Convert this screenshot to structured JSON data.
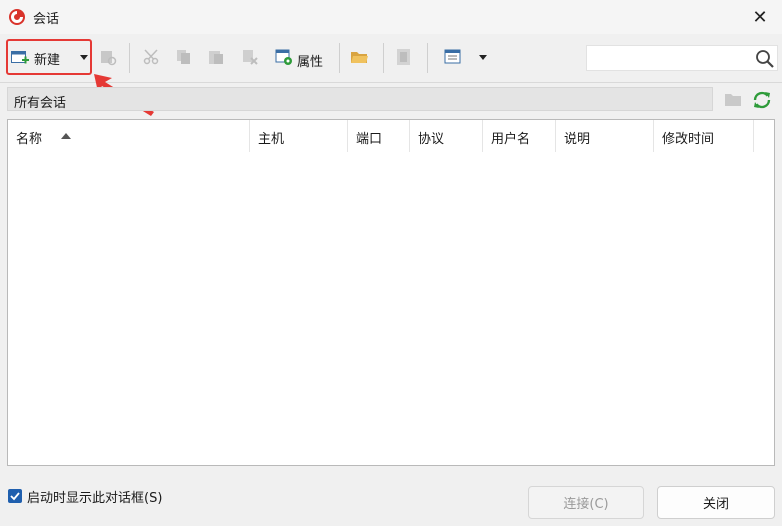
{
  "window": {
    "title": "会话",
    "close_symbol": "✕"
  },
  "toolbar": {
    "new_label": "新建",
    "properties_label": "属性"
  },
  "search": {
    "value": "",
    "placeholder": ""
  },
  "path": {
    "label": "所有会话"
  },
  "table": {
    "columns": [
      "名称",
      "主机",
      "端口",
      "协议",
      "用户名",
      "说明",
      "修改时间"
    ],
    "rows": []
  },
  "footer": {
    "startup_checkbox_label": "启动时显示此对话框(S)",
    "startup_checked": true,
    "connect_label": "连接(C)",
    "close_label": "关闭"
  },
  "colors": {
    "highlight_box": "#e53935",
    "annotation_arrow": "#e53935",
    "refresh_green": "#2e9b3a",
    "checkbox_blue": "#1f5fae"
  },
  "icons": [
    "app-logo-icon",
    "close-icon",
    "new-session-icon",
    "dropdown-arrow-icon",
    "session-manager-icon",
    "cut-icon",
    "copy-icon",
    "paste-icon",
    "delete-icon",
    "properties-icon",
    "open-folder-icon",
    "export-icon",
    "view-icon",
    "search-icon",
    "folder-icon",
    "refresh-icon",
    "sort-ascending-icon",
    "checkmark-icon"
  ]
}
